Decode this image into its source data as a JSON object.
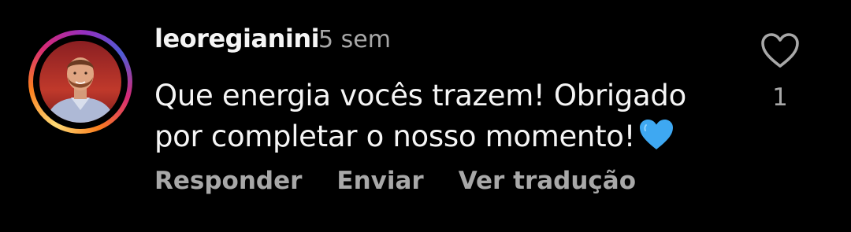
{
  "comment": {
    "username": "leoregianini",
    "time_ago": "5 sem",
    "text_line1": "Que energia vocês trazem! Obrigado",
    "text_line2": "por completar o nosso momento!",
    "emoji": "blue-heart-emoji",
    "like_count": "1"
  },
  "actions": {
    "reply": "Responder",
    "send": "Enviar",
    "translate": "Ver tradução"
  },
  "colors": {
    "background": "#000000",
    "primary_text": "#f5f5f5",
    "secondary_text": "#a8a8a8",
    "emoji_heart": "#3ea8f2"
  },
  "icons": {
    "like": "heart-outline-icon",
    "avatar_ring": "story-gradient-ring"
  }
}
